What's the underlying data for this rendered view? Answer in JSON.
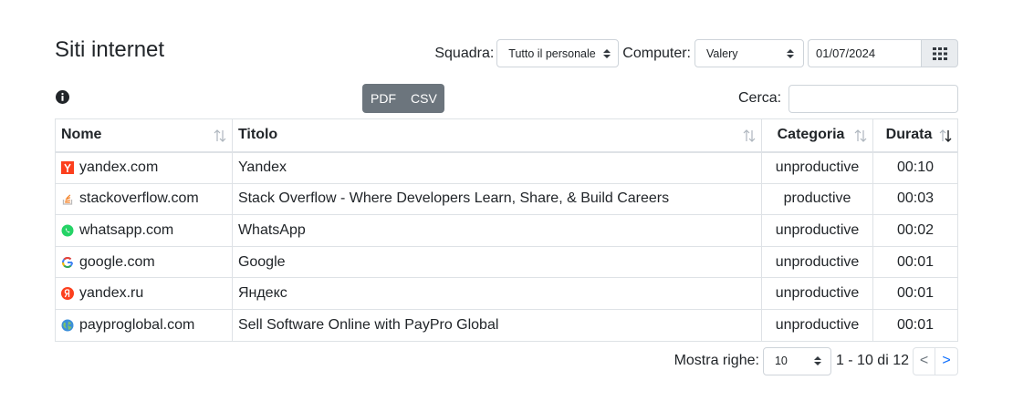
{
  "page": {
    "title": "Siti internet"
  },
  "filters": {
    "team_label": "Squadra:",
    "team_value": "Tutto il personale",
    "computer_label": "Computer:",
    "computer_value": "Valery",
    "date_value": "01/07/2024",
    "calendar_icon": "calendar-grid-icon"
  },
  "toolbar": {
    "info_icon": "info-circle-icon",
    "pdf_label": "PDF",
    "csv_label": "CSV",
    "search_label": "Cerca:",
    "search_value": ""
  },
  "table": {
    "columns": [
      "Nome",
      "Titolo",
      "Categoria",
      "Durata"
    ],
    "rows": [
      {
        "name": "yandex.com",
        "title": "Yandex",
        "category": "unproductive",
        "duration": "00:10",
        "icon": "yandex-com-favicon"
      },
      {
        "name": "stackoverflow.com",
        "title": "Stack Overflow - Where Developers Learn, Share, & Build Careers",
        "category": "productive",
        "duration": "00:03",
        "icon": "stackoverflow-favicon"
      },
      {
        "name": "whatsapp.com",
        "title": "WhatsApp",
        "category": "unproductive",
        "duration": "00:02",
        "icon": "whatsapp-favicon"
      },
      {
        "name": "google.com",
        "title": "Google",
        "category": "unproductive",
        "duration": "00:01",
        "icon": "google-favicon"
      },
      {
        "name": "yandex.ru",
        "title": "Яндекс",
        "category": "unproductive",
        "duration": "00:01",
        "icon": "yandex-ru-favicon"
      },
      {
        "name": "payproglobal.com",
        "title": "Sell Software Online with PayPro Global",
        "category": "unproductive",
        "duration": "00:01",
        "icon": "globe-favicon"
      }
    ]
  },
  "pagination": {
    "rows_label": "Mostra righe:",
    "rows_value": "10",
    "range_text": "1 - 10 di 12",
    "prev_label": "<",
    "next_label": ">"
  }
}
